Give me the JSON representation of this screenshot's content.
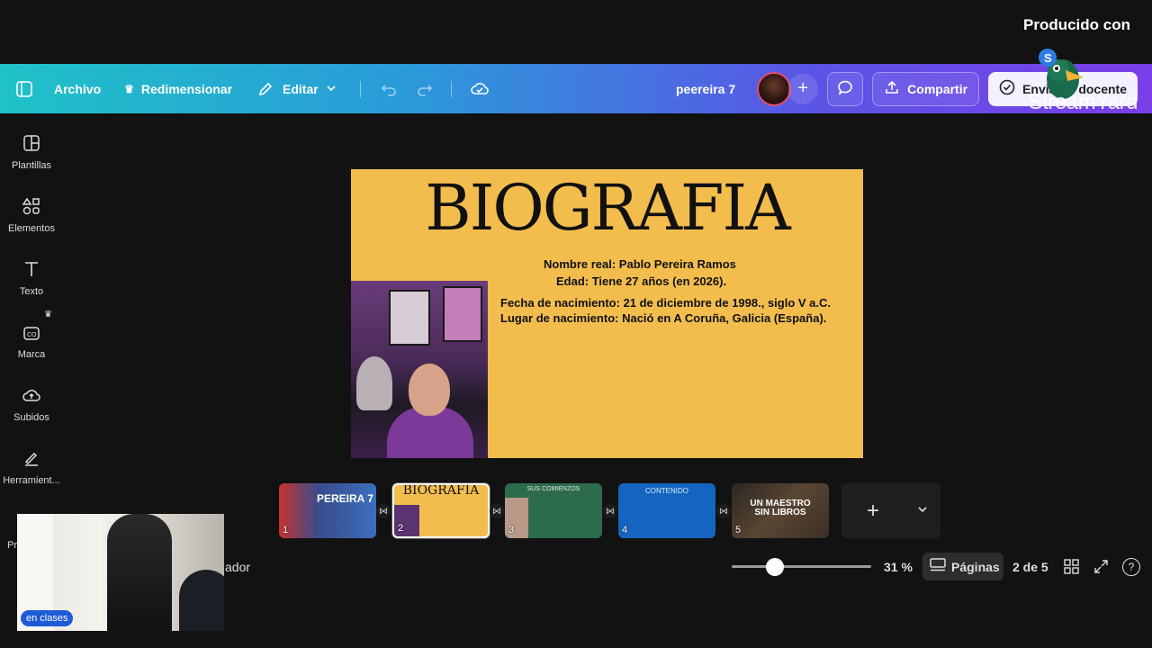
{
  "producer": "Producido con",
  "watermark": "StreamYard",
  "toolbar": {
    "file": "Archivo",
    "resize": "Redimensionar",
    "edit": "Editar",
    "design_name": "peereira 7",
    "share": "Compartir",
    "send": "Enviar al docente"
  },
  "sidebar": {
    "templates": "Plantillas",
    "elements": "Elementos",
    "text": "Texto",
    "brand": "Marca",
    "uploads": "Subidos",
    "tools": "Herramient...",
    "partial_label": "Pr",
    "partial_label2": "ador"
  },
  "slide": {
    "title": "BIOGRAFIA",
    "line1": "Nombre real: Pablo Pereira Ramos",
    "line2": "Edad: Tiene 27 años (en 2026).",
    "line3": "Fecha de nacimiento: 21 de diciembre de 1998., siglo V a.C.",
    "line4": "Lugar de nacimiento: Nació en A Coruña, Galicia (España)."
  },
  "pages": [
    {
      "num": "1",
      "label": "PEREIRA 7"
    },
    {
      "num": "2",
      "label": "BIOGRAFIA"
    },
    {
      "num": "3",
      "label": "SUS COMIENZOS"
    },
    {
      "num": "4",
      "label": "CONTENIDO"
    },
    {
      "num": "5",
      "label": "UN MAESTRO SIN LIBROS"
    }
  ],
  "bottom": {
    "zoom": "31 %",
    "zoom_level": 0.31,
    "pages_btn": "Páginas",
    "page_count": "2 de 5"
  },
  "webcam": {
    "badge": "en clases"
  },
  "colors": {
    "slide_bg": "#f3bd4e",
    "accent": "#7a3ee8"
  }
}
